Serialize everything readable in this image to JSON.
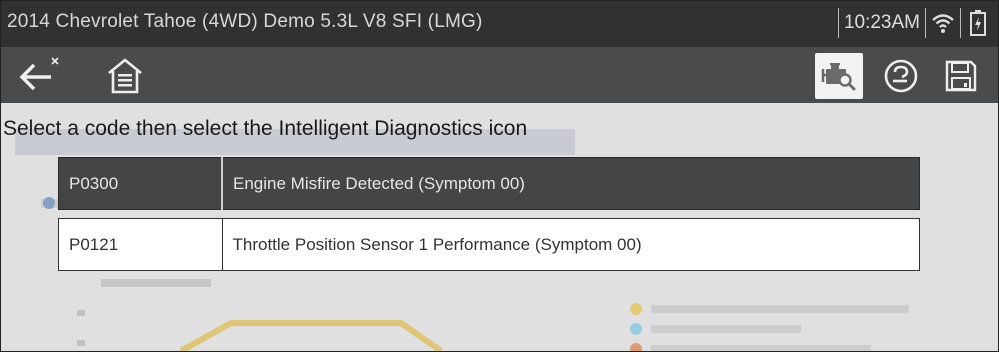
{
  "status_bar": {
    "vehicle_title": "2014 Chevrolet Tahoe (4WD) Demo 5.3L V8 SFI (LMG)",
    "time": "10:23AM",
    "wifi_icon": "wifi-icon",
    "battery_icon": "battery-charging-icon"
  },
  "toolbar": {
    "back_icon": "back-arrow-icon",
    "home_icon": "home-icon",
    "diagnostics_icon": "intelligent-diagnostics-icon",
    "help_icon": "help-icon",
    "save_icon": "save-icon"
  },
  "main": {
    "instruction": "Select a code then select the Intelligent Diagnostics icon",
    "codes": [
      {
        "code": "P0300",
        "description": "Engine Misfire Detected (Symptom 00)",
        "selected": true
      },
      {
        "code": "P0121",
        "description": "Throttle Position Sensor 1 Performance (Symptom 00)",
        "selected": false
      }
    ]
  },
  "colors": {
    "status_bar_bg": "#303132",
    "toolbar_bg": "#4a4b4c",
    "selected_row_bg": "#444546"
  }
}
